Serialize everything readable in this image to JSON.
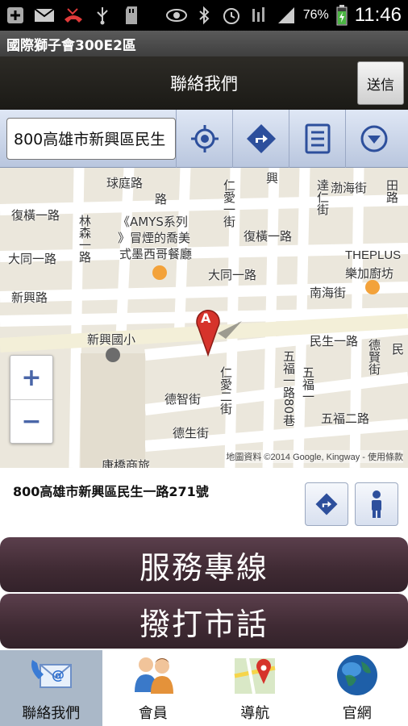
{
  "status_bar": {
    "battery_percent": "76%",
    "time": "11:46",
    "icons": [
      "add-icon",
      "mail-icon",
      "missed-call-icon",
      "usb-icon",
      "sd-card-icon",
      "eye-icon",
      "bluetooth-icon",
      "alarm-icon",
      "network-icon",
      "signal-icon",
      "battery-icon"
    ]
  },
  "app": {
    "title": "國際獅子會300E2區"
  },
  "header": {
    "title": "聯絡我們",
    "send_label": "送信"
  },
  "toolbar": {
    "address_value": "800高雄市新興區民生",
    "buttons": [
      "locate-icon",
      "directions-icon",
      "list-icon",
      "dropdown-icon"
    ]
  },
  "map": {
    "labels": {
      "qiuting": "球庭路",
      "fuheng1": "復橫一路",
      "linsen": "林森一路",
      "datong1_left": "大同一路",
      "xinxing": "新興路",
      "amys1": "《AMYS系列",
      "amys2": "》冒煙的喬美",
      "amys3": "式墨西哥餐廳",
      "xinxing_school": "新興國小",
      "datong1_mid": "大同一路",
      "fuheng1_mid": "復橫一路",
      "renai1": "仁愛一街",
      "renai2": "仁愛二街",
      "xing": "興",
      "road_lu": "路",
      "bohai": "渤海街",
      "nanhai": "南海街",
      "theplus1": "THEPLUS",
      "theplus2": "樂加廚坊",
      "minsheng1": "民生一路",
      "min": "民",
      "dezhi": "德智街",
      "desheng": "德生街",
      "wufu1": "五福一路80巷",
      "wufu_st": "五福一",
      "wufu2": "五福二路",
      "dexian": "德賢街",
      "kangqiao": "康橋商旅",
      "tian": "田路",
      "da": "達仁街",
      "marker": "A"
    },
    "copyright": "地圖資料 ©2014 Google, Kingway - 使用條款"
  },
  "zoom": {
    "in": "+",
    "out": "−"
  },
  "address": {
    "text": "800高雄市新興區民生一路271號"
  },
  "big_buttons": {
    "service": "服務專線",
    "call": "撥打市話"
  },
  "tabs": [
    {
      "label": "聯絡我們",
      "icon": "contact-mail-icon",
      "active": true
    },
    {
      "label": "會員",
      "icon": "members-icon",
      "active": false
    },
    {
      "label": "導航",
      "icon": "navigation-map-icon",
      "active": false
    },
    {
      "label": "官網",
      "icon": "globe-icon",
      "active": false
    }
  ],
  "colors": {
    "header_bg": "#1f1d19",
    "toolbar_bg": "#c9d4e8",
    "big_button": "#3f2a33",
    "active_tab": "#aab8c8",
    "marker": "#d6332b"
  }
}
